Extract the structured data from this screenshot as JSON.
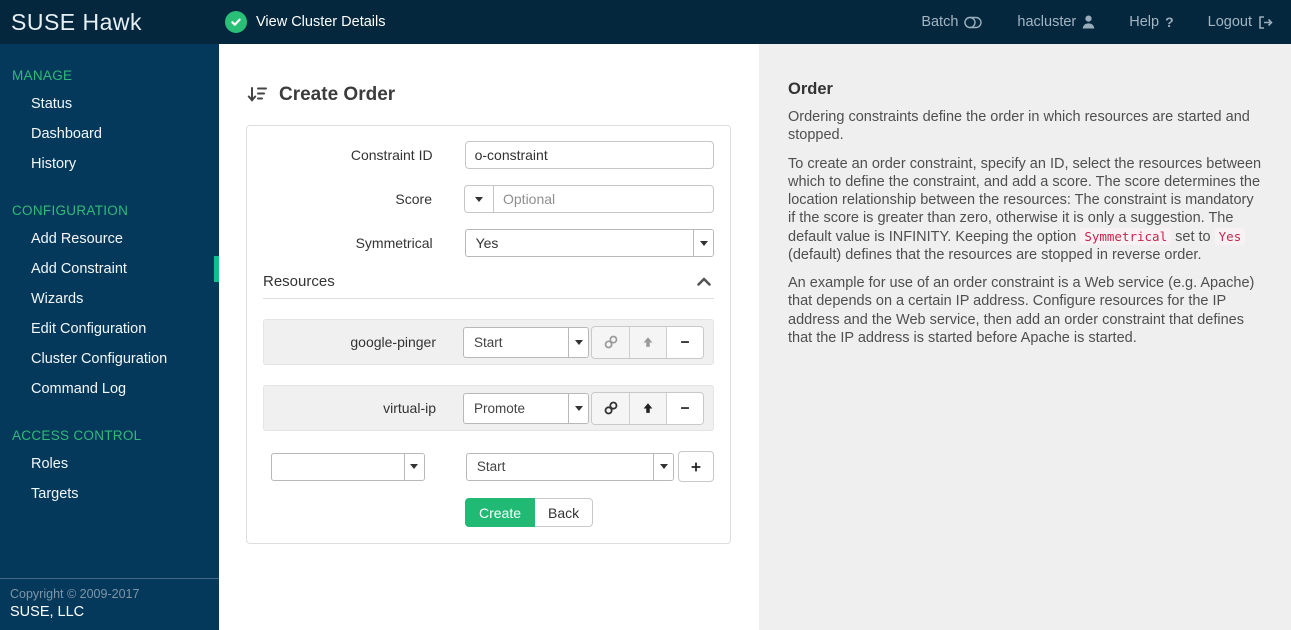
{
  "topbar": {
    "brand": "SUSE Hawk",
    "cluster_status_label": "View Cluster Details",
    "batch_label": "Batch",
    "user_label": "hacluster",
    "help_label": "Help",
    "logout_label": "Logout"
  },
  "sidebar": {
    "sections": [
      {
        "heading": "MANAGE",
        "items": [
          "Status",
          "Dashboard",
          "History"
        ]
      },
      {
        "heading": "CONFIGURATION",
        "items": [
          "Add Resource",
          "Add Constraint",
          "Wizards",
          "Edit Configuration",
          "Cluster Configuration",
          "Command Log"
        ]
      },
      {
        "heading": "ACCESS CONTROL",
        "items": [
          "Roles",
          "Targets"
        ]
      }
    ],
    "active_item": "Add Constraint",
    "copyright": "Copyright © 2009-2017",
    "company": "SUSE, LLC"
  },
  "form": {
    "title": "Create Order",
    "fields": {
      "constraint_id": {
        "label": "Constraint ID",
        "value": "o-constraint"
      },
      "score": {
        "label": "Score",
        "placeholder": "Optional"
      },
      "symmetrical": {
        "label": "Symmetrical",
        "value": "Yes"
      }
    },
    "resources": {
      "heading": "Resources",
      "rows": [
        {
          "name": "google-pinger",
          "action": "Start"
        },
        {
          "name": "virtual-ip",
          "action": "Promote"
        }
      ],
      "new_row": {
        "resource": "",
        "action": "Start"
      }
    },
    "create_label": "Create",
    "back_label": "Back"
  },
  "help": {
    "title": "Order",
    "p1": "Ordering constraints define the order in which resources are started and stopped.",
    "p2a": "To create an order constraint, specify an ID, select the resources between which to define the constraint, and add a score. The score determines the location relationship between the resources: The constraint is mandatory if the score is greater than zero, otherwise it is only a suggestion. The default value is INFINITY. Keeping the option ",
    "p2_code1": "Symmetrical",
    "p2b": " set to ",
    "p2_code2": "Yes",
    "p2c": " (default) defines that the resources are stopped in reverse order.",
    "p3": "An example for use of an order constraint is a Web service (e.g. Apache) that depends on a certain IP address. Configure resources for the IP address and the Web service, then add an order constraint that defines that the IP address is started before Apache is started."
  },
  "colors": {
    "accent_green": "#30ba78",
    "active_indicator": "#0dc18a",
    "create_button": "#21ba75",
    "topbar_bg": "#04273e",
    "sidebar_bg": "#05395c",
    "help_bg": "#efefef",
    "code_text": "#c7254e"
  }
}
